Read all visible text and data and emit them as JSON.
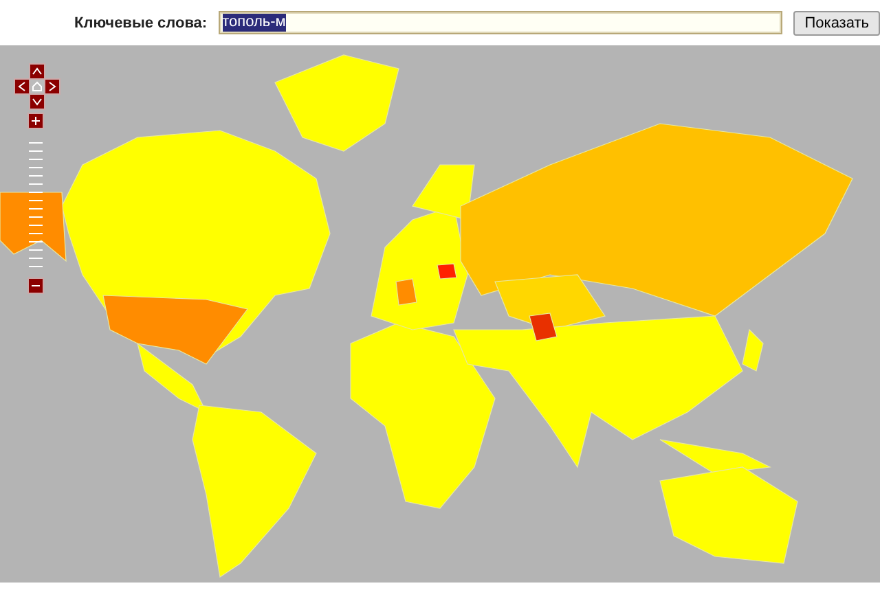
{
  "search": {
    "label": "Ключевые слова:",
    "value": "тополь-м",
    "value_highlighted": true
  },
  "submit_button": "Показать"
}
